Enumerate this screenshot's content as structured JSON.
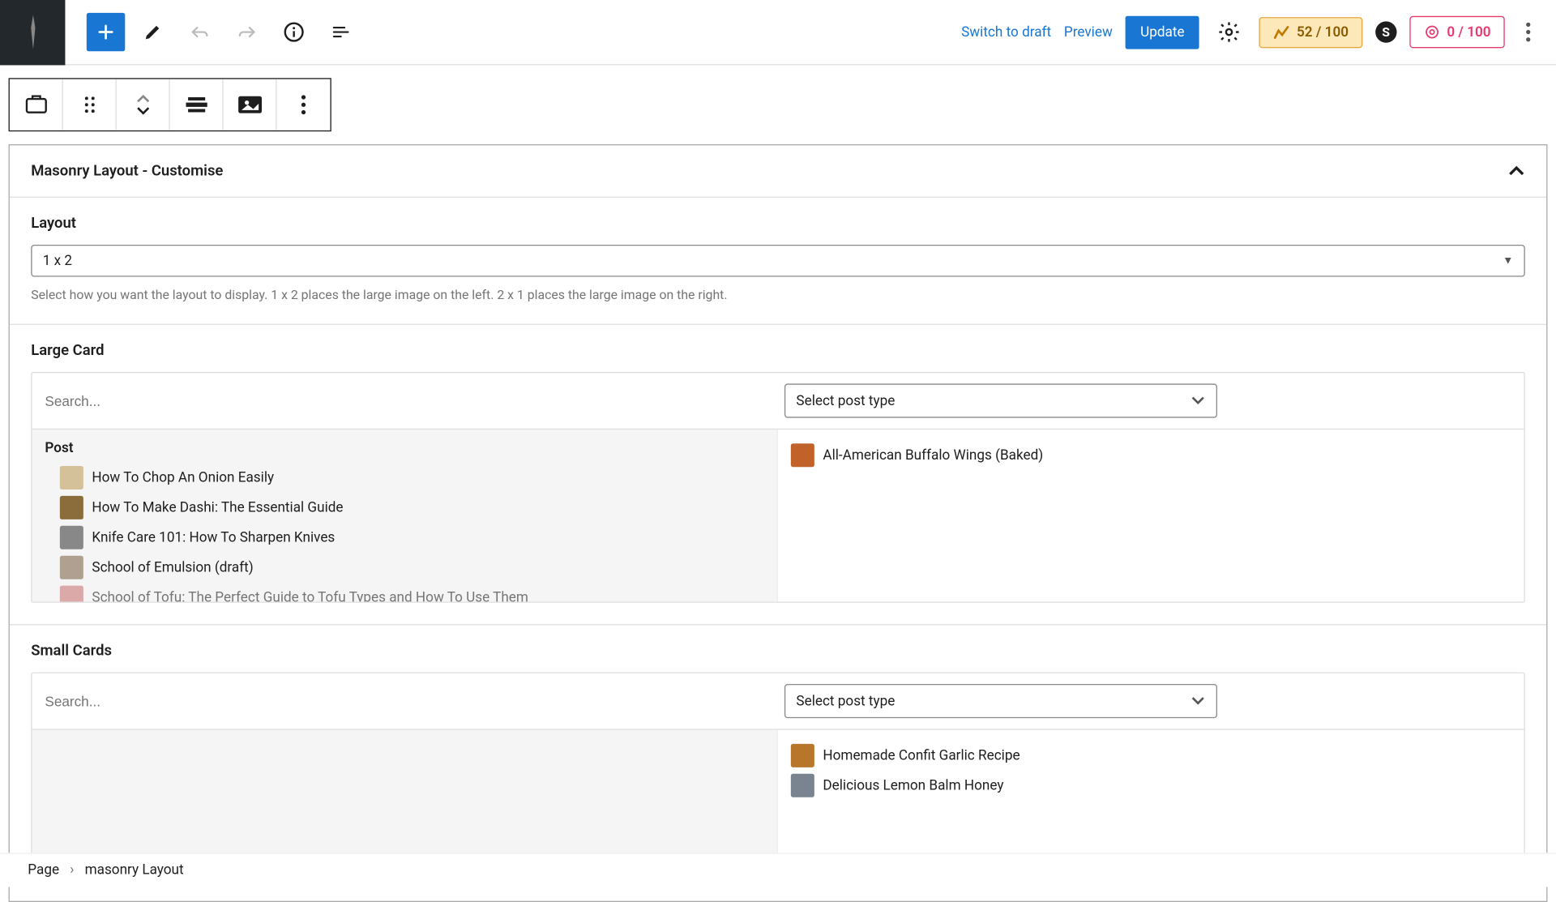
{
  "toolbar": {
    "switch_draft": "Switch to draft",
    "preview": "Preview",
    "update": "Update",
    "score1": "52 / 100",
    "score2": "0 / 100"
  },
  "panel": {
    "title": "Masonry Layout - Customise",
    "layout": {
      "label": "Layout",
      "value": "1 x 2",
      "help": "Select how you want the layout to display. 1 x 2 places the large image on the left. 2 x 1 places the large image on the right."
    },
    "large_card": {
      "label": "Large Card",
      "search_placeholder": "Search...",
      "post_type_placeholder": "Select post type",
      "group_label": "Post",
      "posts": [
        "How To Chop An Onion Easily",
        "How To Make Dashi: The Essential Guide",
        "Knife Care 101: How To Sharpen Knives",
        "School of Emulsion (draft)",
        "School of Tofu: The Perfect Guide to Tofu Types and How To Use Them"
      ],
      "selected": [
        "All-American Buffalo Wings (Baked)"
      ]
    },
    "small_cards": {
      "label": "Small Cards",
      "search_placeholder": "Search...",
      "post_type_placeholder": "Select post type",
      "selected": [
        "Homemade Confit Garlic Recipe",
        "Delicious Lemon Balm Honey"
      ]
    }
  },
  "breadcrumb": {
    "root": "Page",
    "current": "masonry Layout"
  }
}
